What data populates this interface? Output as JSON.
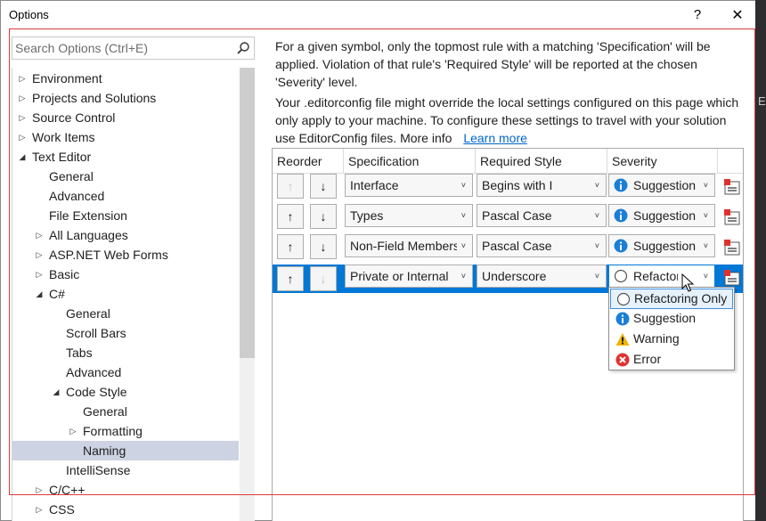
{
  "window": {
    "title": "Options",
    "help_label": "?",
    "close_label": "✕"
  },
  "search": {
    "placeholder": "Search Options (Ctrl+E)",
    "value": ""
  },
  "tree": {
    "items": [
      {
        "label": "Environment"
      },
      {
        "label": "Projects and Solutions"
      },
      {
        "label": "Source Control"
      },
      {
        "label": "Work Items"
      },
      {
        "label": "Text Editor"
      },
      {
        "label": "General"
      },
      {
        "label": "Advanced"
      },
      {
        "label": "File Extension"
      },
      {
        "label": "All Languages"
      },
      {
        "label": "ASP.NET Web Forms"
      },
      {
        "label": "Basic"
      },
      {
        "label": "C#"
      },
      {
        "label": "General"
      },
      {
        "label": "Scroll Bars"
      },
      {
        "label": "Tabs"
      },
      {
        "label": "Advanced"
      },
      {
        "label": "Code Style"
      },
      {
        "label": "General"
      },
      {
        "label": "Formatting"
      },
      {
        "label": "Naming"
      },
      {
        "label": "IntelliSense"
      },
      {
        "label": "C/C++"
      },
      {
        "label": "CSS"
      }
    ]
  },
  "description": {
    "para1": "For a given symbol, only the topmost rule with a matching 'Specification' will be applied. Violation of that rule's 'Required Style' will be reported at the chosen 'Severity' level.",
    "para2": "Your .editorconfig file might override the local settings configured on this page which only apply to your machine. To configure these settings to travel with your solution use EditorConfig files. More info",
    "learn_more": "Learn more"
  },
  "grid": {
    "headers": {
      "reorder": "Reorder",
      "specification": "Specification",
      "required_style": "Required Style",
      "severity": "Severity"
    },
    "rows": [
      {
        "specification": "Interface",
        "required_style": "Begins with I",
        "severity": "Suggestion"
      },
      {
        "specification": "Types",
        "required_style": "Pascal Case",
        "severity": "Suggestion"
      },
      {
        "specification": "Non-Field Members",
        "required_style": "Pascal Case",
        "severity": "Suggestion"
      },
      {
        "specification": "Private or Internal",
        "required_style": "Underscore",
        "severity": "Refactoring Only"
      }
    ]
  },
  "severity_dropdown": {
    "options": [
      "Refactoring Only",
      "Suggestion",
      "Warning",
      "Error"
    ],
    "highlighted": "Refactoring Only"
  },
  "icons": {
    "up": "↑",
    "down": "↓",
    "chevron": "˅",
    "expand": "▷",
    "expanded": "◢"
  },
  "colors": {
    "accent": "#0078d7",
    "info": "#1c7fd6",
    "warning": "#f0b400",
    "error": "#e0312f",
    "selection": "#cdd3e2"
  }
}
